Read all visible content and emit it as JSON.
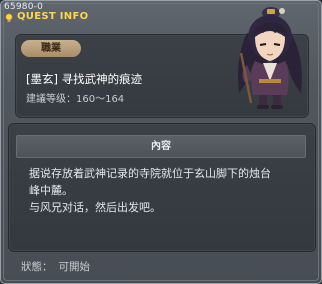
{
  "window": {
    "quest_id": "65980-0",
    "title": "QUEST INFO"
  },
  "header": {
    "job_badge": "職業",
    "quest_name": "[墨玄] 寻找武神的痕迹",
    "level_label": "建議等级：",
    "level_range": "160～164",
    "portrait_icon": "npc-portrait-icon"
  },
  "content": {
    "header_label": "內容",
    "lines": [
      "据说存放着武神记录的寺院就位于玄山脚下的烛台",
      "峰中麓。",
      "与风兄对话，然后出发吧。"
    ]
  },
  "footer": {
    "status_label": "狀態：",
    "status_value": "可開始"
  },
  "colors": {
    "title": "#ffd54a",
    "badge": "#c8b18e",
    "panel": "#3a4046"
  }
}
